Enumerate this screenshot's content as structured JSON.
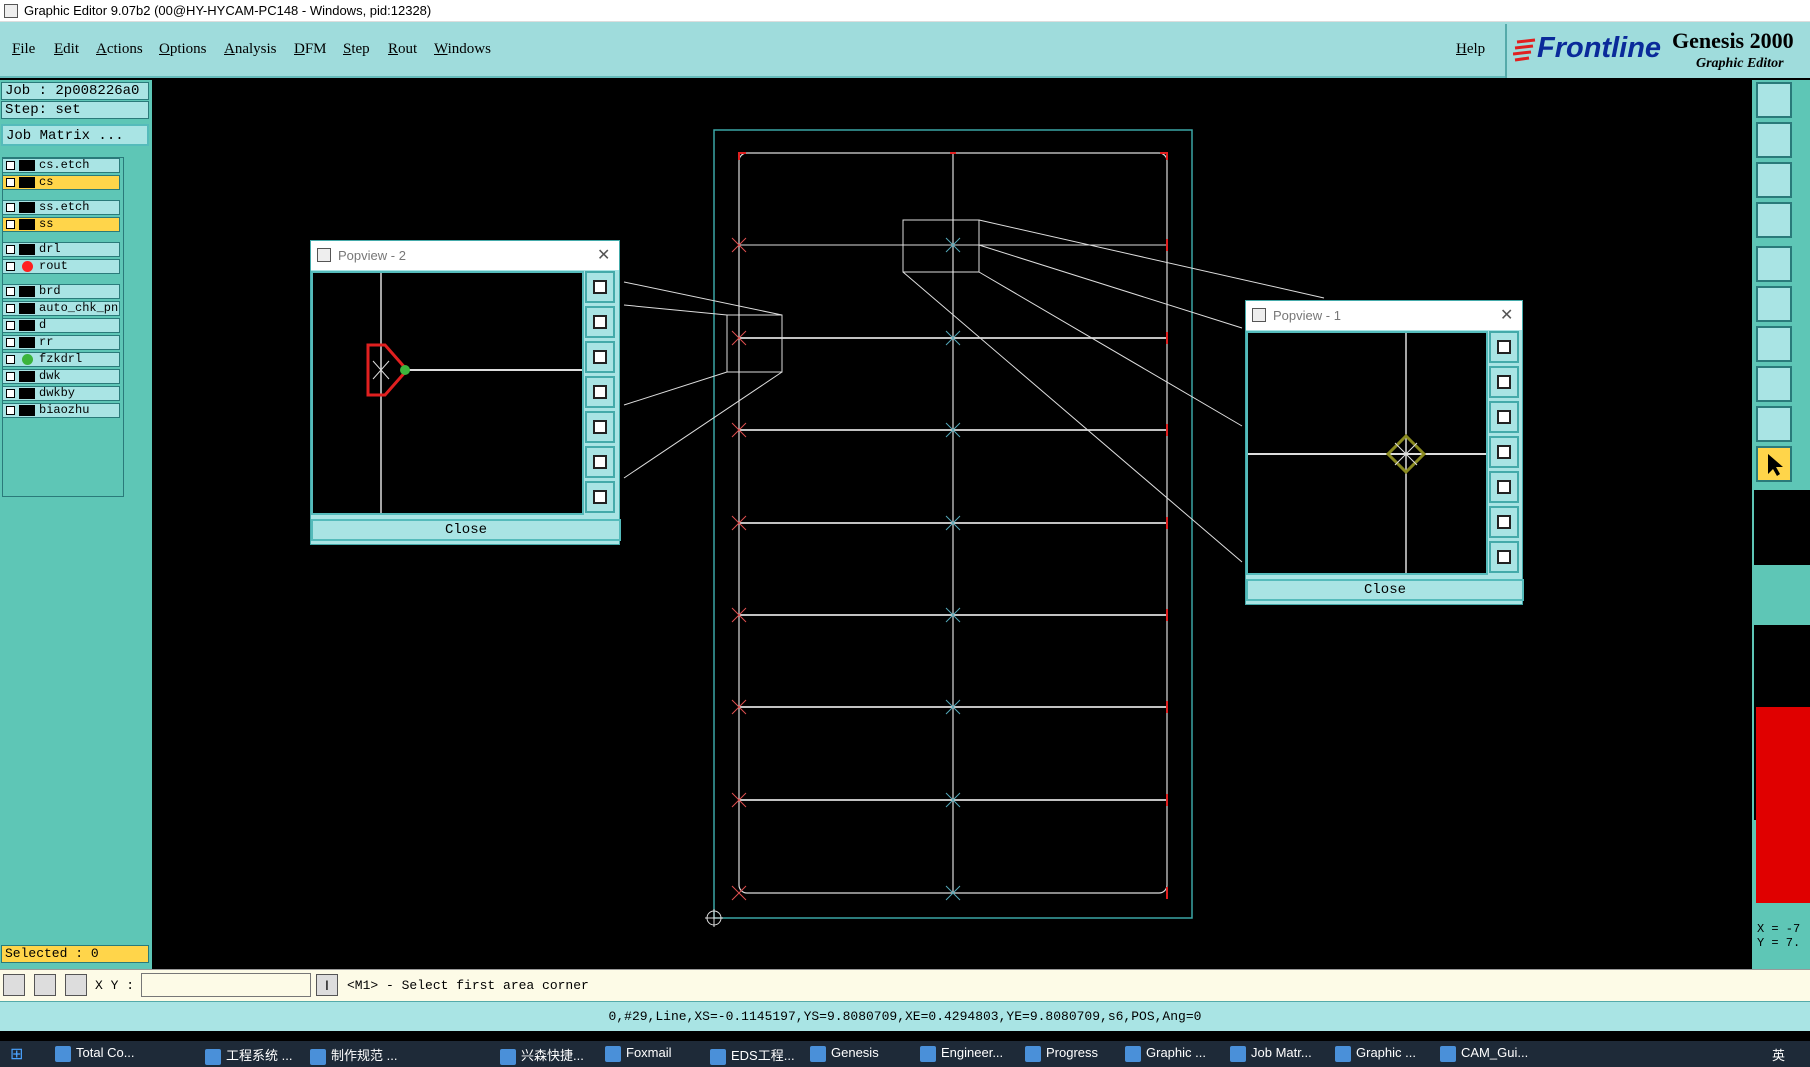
{
  "window": {
    "title": "Graphic Editor 9.07b2 (00@HY-HYCAM-PC148 - Windows, pid:12328)"
  },
  "menu": {
    "items": [
      "File",
      "Edit",
      "Actions",
      "Options",
      "Analysis",
      "DFM",
      "Step",
      "Rout",
      "Windows"
    ],
    "help": "Help"
  },
  "brand": {
    "logo": "Frontline",
    "product": "Genesis 2000",
    "subtitle": "Graphic Editor"
  },
  "job": {
    "job_label": "Job : 2p008226a0",
    "step_label": "Step: set",
    "matrix_button": "Job Matrix ..."
  },
  "layers": [
    {
      "name": "cs.etch",
      "highlight": false,
      "color": "#000000"
    },
    {
      "name": "cs",
      "highlight": true,
      "color": "#000000"
    },
    {
      "name": "ss.etch",
      "highlight": false,
      "color": "#000000"
    },
    {
      "name": "ss",
      "highlight": true,
      "color": "#000000"
    },
    {
      "name": "drl",
      "highlight": false,
      "color": "#000000"
    },
    {
      "name": "rout",
      "highlight": false,
      "color": "#ff2020",
      "active": true
    },
    {
      "name": "brd",
      "highlight": false,
      "color": "#000000"
    },
    {
      "name": "auto_chk_pn",
      "highlight": false,
      "color": "#000000"
    },
    {
      "name": "d",
      "highlight": false,
      "color": "#000000"
    },
    {
      "name": "rr",
      "highlight": false,
      "color": "#000000"
    },
    {
      "name": "fzkdrl",
      "highlight": false,
      "color": "#3cb43c"
    },
    {
      "name": "dwk",
      "highlight": false,
      "color": "#000000"
    },
    {
      "name": "dwkby",
      "highlight": false,
      "color": "#000000"
    },
    {
      "name": "biaozhu",
      "highlight": false,
      "color": "#000000"
    }
  ],
  "selected": "Selected : 0",
  "popview1": {
    "title": "Popview - 1",
    "close": "Close"
  },
  "popview2": {
    "title": "Popview - 2",
    "close": "Close"
  },
  "coords": {
    "x": "X = -7",
    "y": "Y = 7."
  },
  "command": {
    "xy_label": "X Y :",
    "xy_value": "",
    "prompt": "<M1> - Select first area corner"
  },
  "status": "0,#29,Line,XS=-0.1145197,YS=9.8080709,XE=0.4294803,YE=9.8080709,s6,POS,Ang=0",
  "taskbar": {
    "items": [
      "Total Co...",
      "工程系统 ...",
      "制作规范 ...",
      "兴森快捷...",
      "Foxmail",
      "EDS工程...",
      "Genesis",
      "Engineer...",
      "Progress",
      "Graphic ...",
      "Job Matr...",
      "Graphic ...",
      "CAM_Gui..."
    ],
    "tray_lang": "英"
  }
}
